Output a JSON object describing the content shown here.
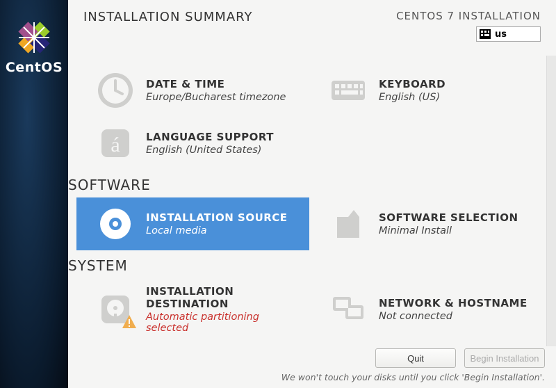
{
  "brand": "CentOS",
  "header": {
    "title": "INSTALLATION SUMMARY",
    "subtitle": "CENTOS 7 INSTALLATION",
    "keyboard_layout": "us"
  },
  "sections": {
    "localization_items": {
      "datetime": {
        "title": "DATE & TIME",
        "status": "Europe/Bucharest timezone"
      },
      "keyboard": {
        "title": "KEYBOARD",
        "status": "English (US)"
      },
      "language": {
        "title": "LANGUAGE SUPPORT",
        "status": "English (United States)"
      }
    },
    "software_label": "SOFTWARE",
    "software_items": {
      "source": {
        "title": "INSTALLATION SOURCE",
        "status": "Local media"
      },
      "selection": {
        "title": "SOFTWARE SELECTION",
        "status": "Minimal Install"
      }
    },
    "system_label": "SYSTEM",
    "system_items": {
      "destination": {
        "title": "INSTALLATION DESTINATION",
        "status": "Automatic partitioning selected"
      },
      "network": {
        "title": "NETWORK & HOSTNAME",
        "status": "Not connected"
      }
    }
  },
  "footer": {
    "quit": "Quit",
    "begin": "Begin Installation",
    "note": "We won't touch your disks until you click 'Begin Installation'."
  }
}
